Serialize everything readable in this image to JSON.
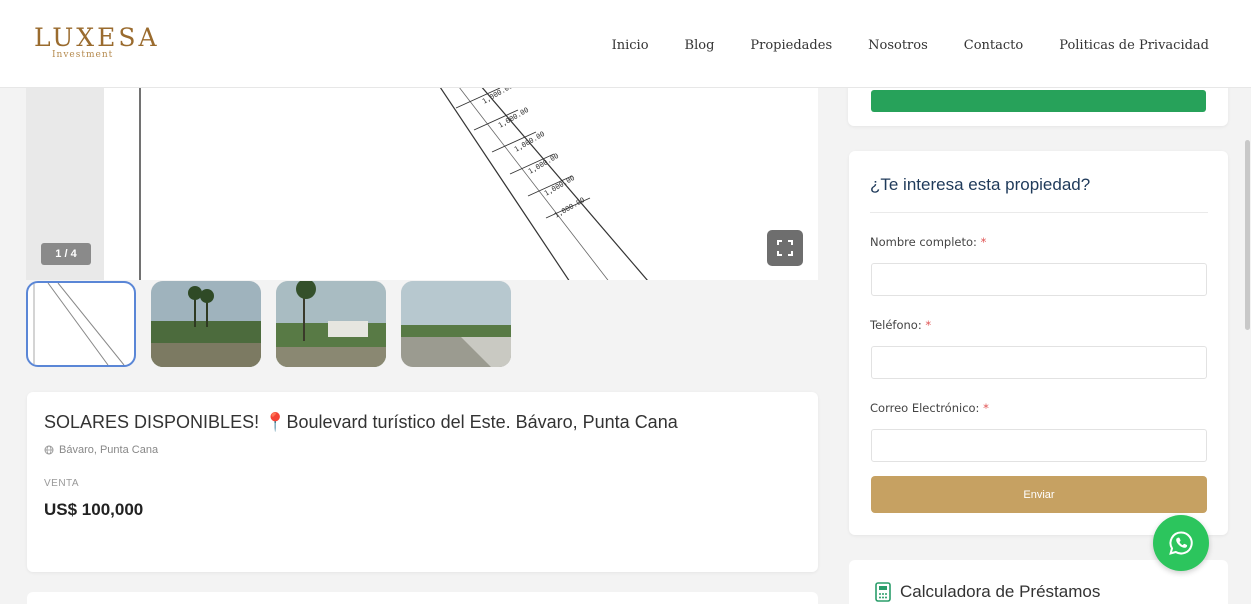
{
  "brand": {
    "name": "LUXESA",
    "tagline": "Investment"
  },
  "nav": {
    "items": [
      {
        "label": "Inicio"
      },
      {
        "label": "Blog"
      },
      {
        "label": "Propiedades"
      },
      {
        "label": "Nosotros"
      },
      {
        "label": "Contacto"
      },
      {
        "label": "Politicas de Privacidad"
      }
    ]
  },
  "gallery": {
    "counter": "1 / 4",
    "current": 1,
    "total": 4,
    "plan_labels": [
      "1,000.00",
      "1,000.00",
      "1,000.00",
      "1,000.00",
      "1,000.00",
      "1,000.00"
    ]
  },
  "property": {
    "title_prefix": "SOLARES DISPONIBLES! ",
    "pin_icon": "📍",
    "title_rest": "Boulevard turístico del Este. Bávaro, Punta Cana",
    "location": "Bávaro, Punta Cana",
    "operation": "VENTA",
    "price": "US$ 100,000"
  },
  "contact_form": {
    "title": "¿Te interesa esta propiedad?",
    "name_label": "Nombre completo:",
    "phone_label": "Teléfono:",
    "email_label": "Correo Electrónico:",
    "required_mark": "*",
    "submit_label": "Enviar"
  },
  "calculator": {
    "title": "Calculadora de Préstamos"
  },
  "colors": {
    "brand_gold": "#9a6b2e",
    "button_gold": "#c6a162",
    "whatsapp_green": "#2cc55d",
    "title_navy": "#1f3a5a"
  }
}
